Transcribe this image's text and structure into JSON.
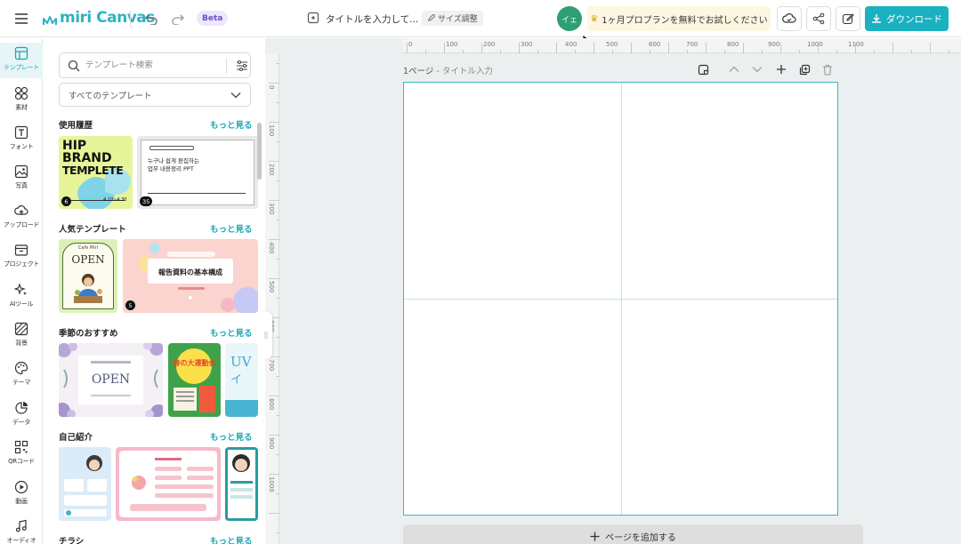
{
  "header": {
    "logo": "miri Canvas",
    "beta": "Beta",
    "doc_title": "タイトルを入力して...",
    "size_button": "サイズ調整",
    "avatar": "イェ",
    "promo": "1ヶ月プロプランを無料でお試しください",
    "download": "ダウンロード",
    "accent": "#1bb1c1"
  },
  "rail": {
    "items": [
      {
        "label": "テンプレート",
        "icon": "template-icon"
      },
      {
        "label": "素材",
        "icon": "elements-icon"
      },
      {
        "label": "フォント",
        "icon": "text-icon"
      },
      {
        "label": "写真",
        "icon": "photo-icon"
      },
      {
        "label": "アップロード",
        "icon": "upload-icon"
      },
      {
        "label": "プロジェクト",
        "icon": "folder-icon"
      },
      {
        "label": "AIツール",
        "icon": "ai-sparkle-icon"
      },
      {
        "label": "背景",
        "icon": "background-icon"
      },
      {
        "label": "テーマ",
        "icon": "palette-icon"
      },
      {
        "label": "データ",
        "icon": "chart-icon"
      },
      {
        "label": "QRコード",
        "icon": "qr-icon"
      },
      {
        "label": "動画",
        "icon": "video-icon"
      },
      {
        "label": "オーディオ",
        "icon": "music-icon"
      }
    ]
  },
  "panel": {
    "search_placeholder": "テンプレート検索",
    "category_select": "すべてのテンプレート",
    "sections": [
      {
        "title": "使用履歴",
        "more": "もっと見る"
      },
      {
        "title": "人気テンプレート",
        "more": "もっと見る"
      },
      {
        "title": "季節のおすすめ",
        "more": "もっと見る"
      },
      {
        "title": "自己紹介",
        "more": "もっと見る"
      },
      {
        "title": "チラシ",
        "more": "もっと見る"
      }
    ],
    "thumbs": {
      "hip_line1": "HIP",
      "hip_line2": "BRAND",
      "hip_line3": "TEMPLETE",
      "hip_date": "4.10~4.30",
      "hip_badge": "6",
      "kr_line1": "누구나 쉽게 편집하는",
      "kr_line2": "업무 내용정리 PPT",
      "kr_badge": "35",
      "cafe_open": "OPEN",
      "cafe_top": "Cafe Miri",
      "report_title": "報告資料の基本構成",
      "report_badge": "5",
      "spring_open": "OPEN",
      "sports": "春の大運動会",
      "uv": "UV",
      "uv2": "イ"
    }
  },
  "ruler": {
    "top_ticks": [
      "0",
      "100",
      "200",
      "300",
      "400",
      "500",
      "600",
      "700",
      "800",
      "900",
      "1000",
      "1100"
    ],
    "left_ticks": [
      "0",
      "100",
      "200",
      "300",
      "400",
      "500",
      "600",
      "700",
      "800",
      "900",
      "1000"
    ]
  },
  "canvas": {
    "page_number": "1ページ",
    "page_title_placeholder": "タイトル入力",
    "add_page": "ページを追加する"
  }
}
